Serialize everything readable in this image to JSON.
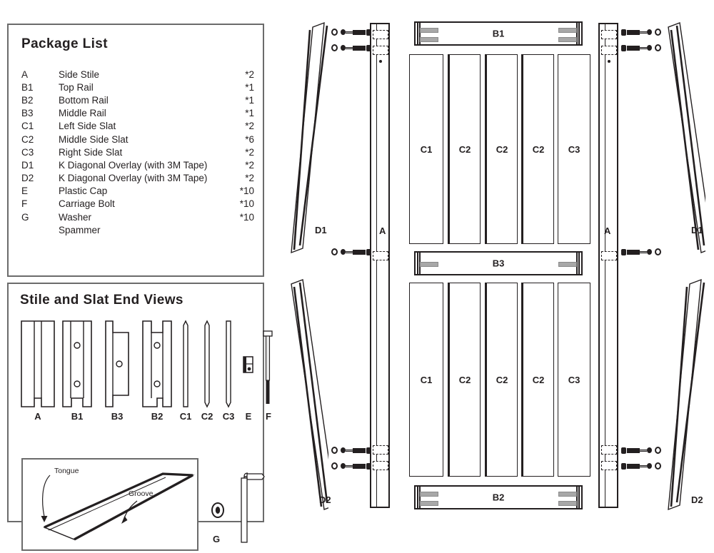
{
  "package_list": {
    "title": "Package List",
    "rows": [
      {
        "code": "A",
        "name": "Side Stile",
        "qty": "*2"
      },
      {
        "code": "B1",
        "name": "Top Rail",
        "qty": "*1"
      },
      {
        "code": "B2",
        "name": "Bottom Rail",
        "qty": "*1"
      },
      {
        "code": "B3",
        "name": "Middle Rail",
        "qty": "*1"
      },
      {
        "code": "C1",
        "name": "Left Side Slat",
        "qty": "*2"
      },
      {
        "code": "C2",
        "name": "Middle Side Slat",
        "qty": "*6"
      },
      {
        "code": "C3",
        "name": "Right Side Slat",
        "qty": "*2"
      },
      {
        "code": "D1",
        "name": "K Diagonal Overlay (with 3M Tape)",
        "qty": "*2"
      },
      {
        "code": "D2",
        "name": "K Diagonal Overlay (with 3M Tape)",
        "qty": "*2"
      },
      {
        "code": "E",
        "name": "Plastic Cap",
        "qty": "*10"
      },
      {
        "code": "F",
        "name": "Carriage Bolt",
        "qty": "*10"
      },
      {
        "code": "G",
        "name": "Washer",
        "qty": "*10"
      },
      {
        "code": "",
        "name": "Spammer",
        "qty": ""
      }
    ]
  },
  "end_views": {
    "title": "Stile and Slat End Views",
    "labels": [
      "A",
      "B1",
      "B3",
      "B2",
      "C1",
      "C2",
      "C3",
      "E",
      "F"
    ],
    "tongue_label": "Tongue",
    "groove_label": "Groove",
    "washer_label": "G"
  },
  "assembly": {
    "overlay_top_left": "D1",
    "overlay_top_right": "D1",
    "overlay_bottom_left": "D2",
    "overlay_bottom_right": "D2",
    "stile_left": "A",
    "stile_right": "A",
    "rails": [
      {
        "id": "B1",
        "tabs": 2
      },
      {
        "id": "B3",
        "tabs": 1
      },
      {
        "id": "B2",
        "tabs": 2
      }
    ],
    "slat_panel_upper": [
      "C1",
      "C2",
      "C2",
      "C2",
      "C3"
    ],
    "slat_panel_lower": [
      "C1",
      "C2",
      "C2",
      "C2",
      "C3"
    ]
  },
  "colors": {
    "ink": "#231f20",
    "panel_border": "#6b6b6b",
    "metal_gray": "#a8a8a8",
    "background": "#ffffff"
  }
}
